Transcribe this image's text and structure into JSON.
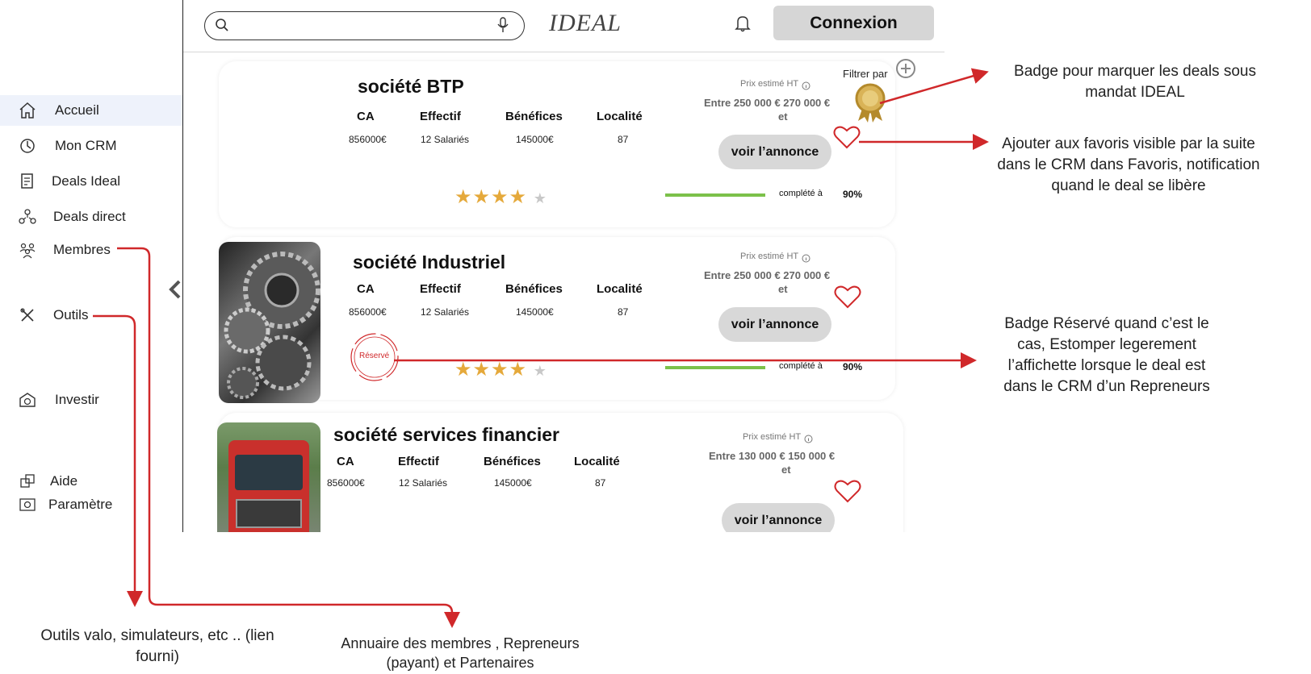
{
  "header": {
    "search_placeholder": "",
    "logo_text": "IDEAL",
    "connexion_label": "Connexion"
  },
  "sidebar": {
    "items": [
      {
        "label": "Accueil",
        "icon": "home-icon"
      },
      {
        "label": "Mon CRM",
        "icon": "crm-icon"
      },
      {
        "label": "Deals Ideal",
        "icon": "document-icon"
      },
      {
        "label": "Deals direct",
        "icon": "network-icon"
      },
      {
        "label": "Membres",
        "icon": "members-icon"
      },
      {
        "label": "Outils",
        "icon": "tools-icon"
      },
      {
        "label": "Investir",
        "icon": "invest-icon"
      },
      {
        "label": "Aide",
        "icon": "help-icon"
      },
      {
        "label": "Paramètre",
        "icon": "settings-icon"
      }
    ]
  },
  "filter": {
    "label": "Filtrer par"
  },
  "metric_headers": {
    "ca": "CA",
    "effectif": "Effectif",
    "benefices": "Bénéfices",
    "localite": "Localité"
  },
  "price_label": "Prix estimé HT",
  "view_label": "voir l’annonce",
  "completion_label": "complété à",
  "cards": [
    {
      "name": "société BTP",
      "ca": "856000€",
      "effectif": "12 Salariés",
      "benefices": "145000€",
      "localite": "87",
      "price_range": "Entre 250 000  € 270 000 €",
      "price_et": "et",
      "completion": "90%",
      "rating": 4,
      "badge": "award-badge"
    },
    {
      "name": "société Industriel",
      "ca": "856000€",
      "effectif": "12 Salariés",
      "benefices": "145000€",
      "localite": "87",
      "price_range": "Entre 250 000  € 270 000 €",
      "price_et": "et",
      "completion": "90%",
      "rating": 4,
      "reserved_label": "Réservé"
    },
    {
      "name": "société services financier",
      "ca": "856000€",
      "effectif": "12 Salariés",
      "benefices": "145000€",
      "localite": "87",
      "price_range": "Entre 130 000  € 150 000 €",
      "price_et": "et"
    }
  ],
  "annotations": {
    "badge_ideal": "Badge pour marquer les deals sous mandat IDEAL",
    "favoris": "Ajouter aux favoris visible par la suite dans le CRM dans Favoris, notification quand le deal se libère",
    "reserve": "Badge Réservé quand c’est le cas, Estomper legerement l’affichette lorsque le deal est dans le CRM d’un Repreneurs",
    "outils": "Outils valo, simulateurs, etc .. (lien fourni)",
    "membres": "Annuaire des membres , Repreneurs (payant)  et Partenaires"
  },
  "colors": {
    "accent_red": "#d0282a",
    "progress_green": "#7cc14a",
    "star_gold": "#e5a93b"
  }
}
